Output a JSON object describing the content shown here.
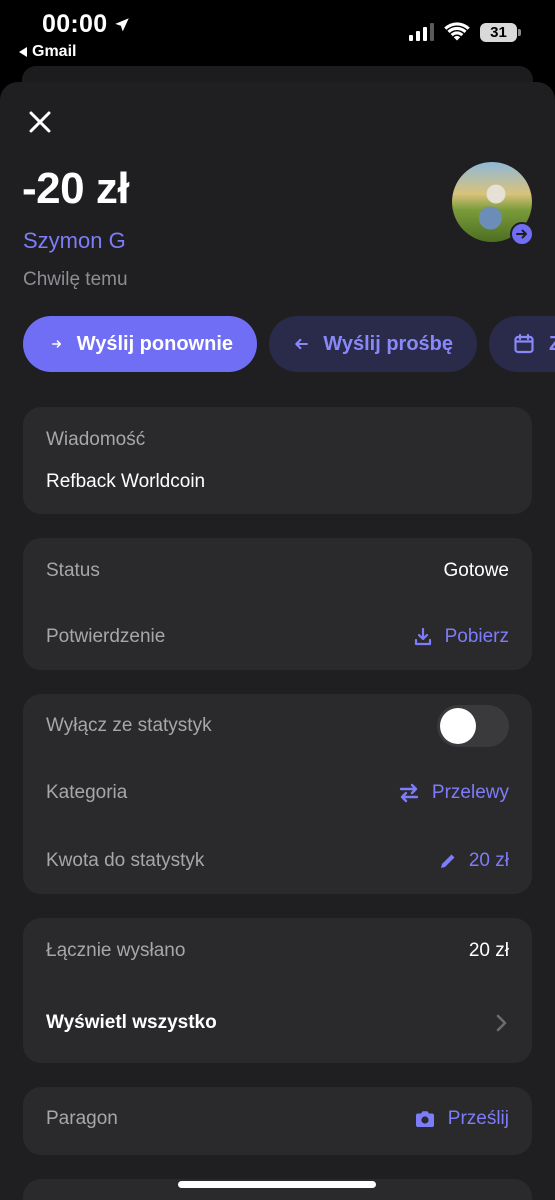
{
  "status_bar": {
    "time": "00:00",
    "back_app": "Gmail",
    "battery": "31"
  },
  "transaction": {
    "amount": "-20 zł",
    "contact_name": "Szymon G",
    "time_ago": "Chwilę temu"
  },
  "actions": {
    "resend": "Wyślij ponownie",
    "request": "Wyślij prośbę",
    "schedule": "Z"
  },
  "message_card": {
    "label": "Wiadomość",
    "text": "Refback Worldcoin"
  },
  "status_card": {
    "status_label": "Status",
    "status_value": "Gotowe",
    "confirmation_label": "Potwierdzenie",
    "download_label": "Pobierz"
  },
  "stats_card": {
    "exclude_label": "Wyłącz ze statystyk",
    "exclude_on": false,
    "category_label": "Kategoria",
    "category_value": "Przelewy",
    "stats_amount_label": "Kwota do statystyk",
    "stats_amount_value": "20 zł"
  },
  "sent_card": {
    "total_label": "Łącznie wysłano",
    "total_value": "20 zł",
    "view_all_label": "Wyświetl wszystko"
  },
  "receipt_card": {
    "label": "Paragon",
    "upload_label": "Prześlij"
  },
  "colors": {
    "accent": "#6f6ef5",
    "accent_text": "#7d7cf9",
    "card_bg": "#2a2a2c",
    "sheet_bg": "#1f1f21"
  }
}
